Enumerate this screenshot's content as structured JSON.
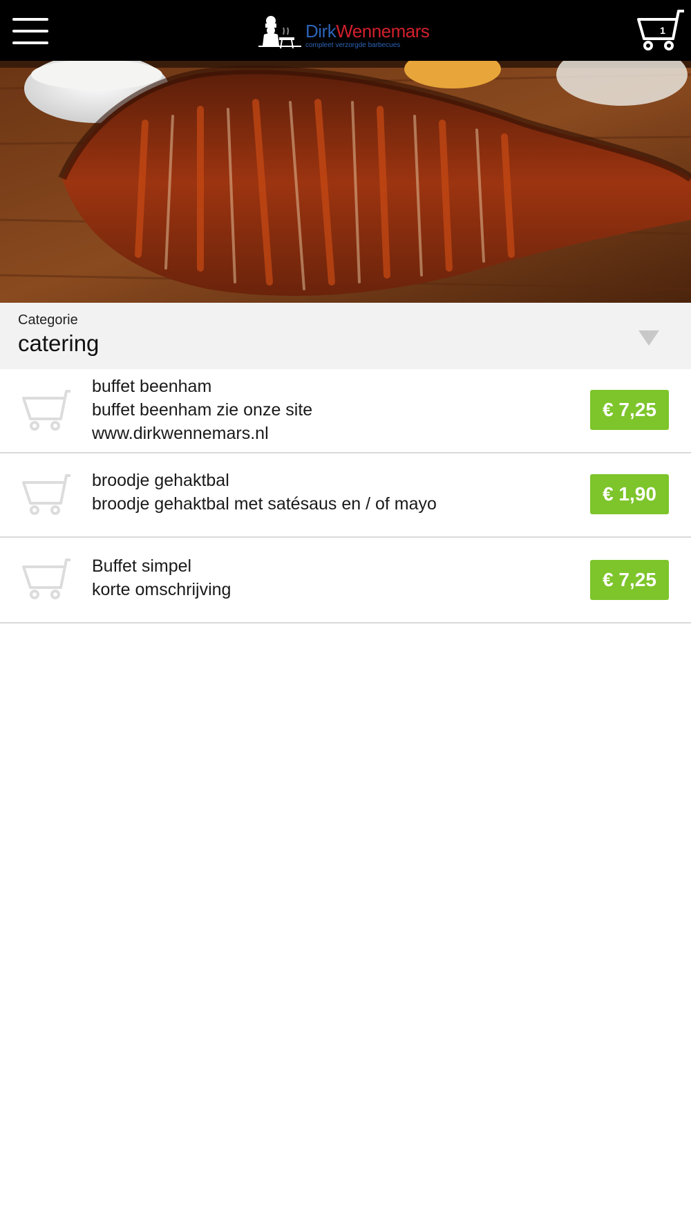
{
  "header": {
    "logo": {
      "first": "Dirk",
      "last": "Wennemars",
      "tagline": "compleet verzorgde barbecues"
    },
    "cart_count": "1"
  },
  "category": {
    "label": "Categorie",
    "value": "catering"
  },
  "products": [
    {
      "name": "buffet beenham",
      "description": "buffet beenham zie onze site www.dirkwennemars.nl",
      "price": "€ 7,25"
    },
    {
      "name": "broodje gehaktbal",
      "description": "broodje gehaktbal met satésaus en / of mayo",
      "price": "€ 1,90"
    },
    {
      "name": "Buffet simpel",
      "description": "korte omschrijving",
      "price": "€ 7,25"
    }
  ],
  "colors": {
    "header_bg": "#000000",
    "price_bg": "#7dc52b",
    "category_bg": "#f2f2f2",
    "logo_blue": "#2c64b8",
    "logo_red": "#d3202c"
  },
  "icons": {
    "menu": "hamburger-menu-icon",
    "cart": "shopping-cart-icon",
    "dropdown": "triangle-down-icon"
  }
}
